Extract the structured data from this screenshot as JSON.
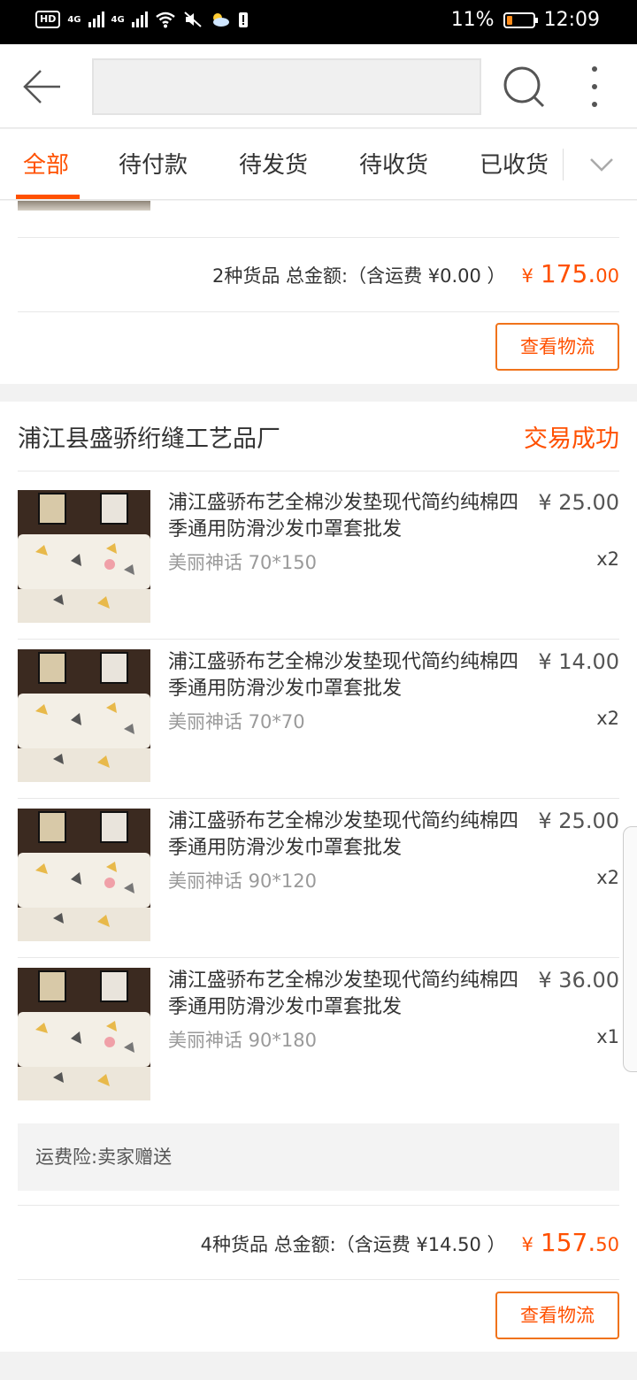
{
  "status_bar": {
    "network_left": "HD",
    "signal1": "4G",
    "signal2": "4G",
    "battery_pct": "11%",
    "time": "12:09"
  },
  "header": {
    "search_placeholder": ""
  },
  "tabs": [
    {
      "label": "全部",
      "active": true
    },
    {
      "label": "待付款",
      "active": false
    },
    {
      "label": "待发货",
      "active": false
    },
    {
      "label": "待收货",
      "active": false
    },
    {
      "label": "已收货",
      "active": false
    }
  ],
  "orders": [
    {
      "summary_prefix": "2种货品 总金额:（含运费 ¥0.00 ）",
      "price_symbol": "¥",
      "price_int": "175.",
      "price_dec": "00",
      "logistics_label": "查看物流"
    },
    {
      "shop_name": "浦江县盛骄绗缝工艺品厂",
      "status": "交易成功",
      "items": [
        {
          "title": "浦江盛骄布艺全棉沙发垫现代简约纯棉四季通用防滑沙发巾罩套批发",
          "spec": "美丽神话 70*150",
          "price": "¥ 25.00",
          "qty": "x2"
        },
        {
          "title": "浦江盛骄布艺全棉沙发垫现代简约纯棉四季通用防滑沙发巾罩套批发",
          "spec": "美丽神话 70*70",
          "price": "¥ 14.00",
          "qty": "x2"
        },
        {
          "title": "浦江盛骄布艺全棉沙发垫现代简约纯棉四季通用防滑沙发巾罩套批发",
          "spec": "美丽神话 90*120",
          "price": "¥ 25.00",
          "qty": "x2"
        },
        {
          "title": "浦江盛骄布艺全棉沙发垫现代简约纯棉四季通用防滑沙发巾罩套批发",
          "spec": "美丽神话 90*180",
          "price": "¥ 36.00",
          "qty": "x1"
        }
      ],
      "insurance": "运费险:卖家赠送",
      "summary_prefix": "4种货品 总金额:（含运费 ¥14.50 ）",
      "price_symbol": "¥",
      "price_int": "157.",
      "price_dec": "50",
      "logistics_label": "查看物流"
    }
  ],
  "colors": {
    "accent": "#ff5000",
    "status_bar": "#000000"
  }
}
